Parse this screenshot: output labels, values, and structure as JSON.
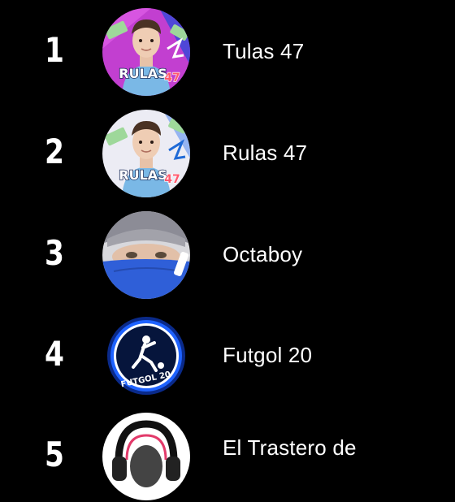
{
  "ranking": [
    {
      "rank": "1",
      "name": "Tulas 47",
      "avatar_icon": "channel-avatar-rulas",
      "avatar_text": "RULAS47"
    },
    {
      "rank": "2",
      "name": "Rulas 47",
      "avatar_icon": "channel-avatar-rulas",
      "avatar_text": "RULAS47"
    },
    {
      "rank": "3",
      "name": "Octaboy",
      "avatar_icon": "channel-avatar-masked-face"
    },
    {
      "rank": "4",
      "name": "Futgol 20",
      "avatar_icon": "channel-avatar-futgol-logo",
      "avatar_text": "FUTGOL 20"
    },
    {
      "rank": "5",
      "name": "El Trastero de",
      "avatar_icon": "channel-avatar-headphones"
    }
  ],
  "colors": {
    "background": "#000000",
    "text": "#ffffff",
    "avatar1_background": "#c23fd0",
    "avatar2_background": "#ececf4",
    "jersey_blue": "#7ab8e6",
    "mask_blue": "#2f5fd8",
    "futgol_ring": "#1e62ff"
  }
}
